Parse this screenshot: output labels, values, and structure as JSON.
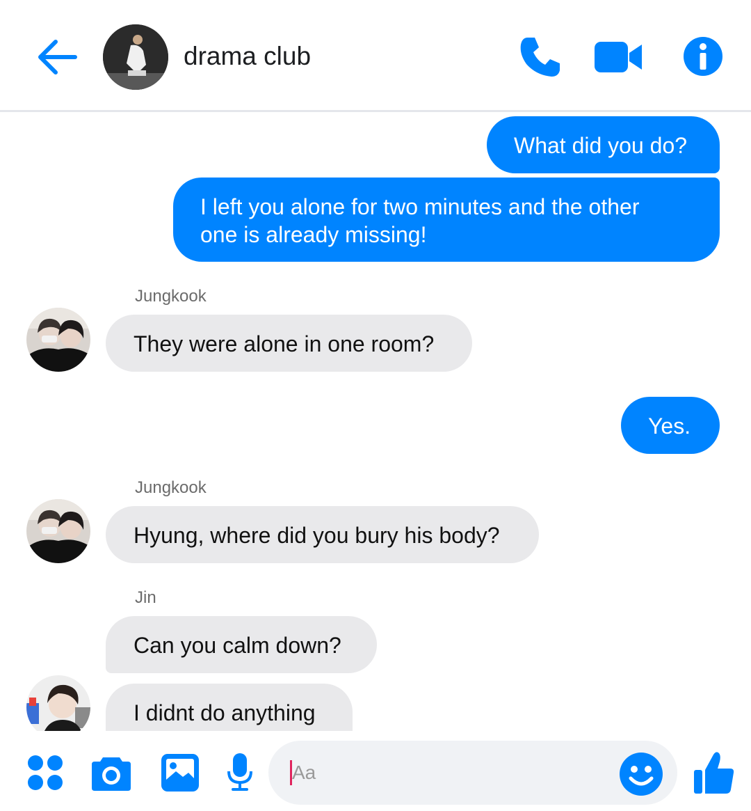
{
  "header": {
    "title": "drama club",
    "back_icon": "arrow-left-icon",
    "call_icon": "phone-icon",
    "video_icon": "video-camera-icon",
    "info_icon": "info-icon"
  },
  "colors": {
    "accent": "#0084ff",
    "incoming_bubble": "#e9e9eb",
    "caret": "#e0245e"
  },
  "messages": [
    {
      "direction": "outgoing",
      "text": "What did you do?"
    },
    {
      "direction": "outgoing",
      "lines": [
        "I left you alone for two minutes and the other",
        "one is already missing!"
      ]
    },
    {
      "direction": "incoming",
      "sender": "Jungkook",
      "text": "They were alone in one room?"
    },
    {
      "direction": "outgoing",
      "text": "Yes."
    },
    {
      "direction": "incoming",
      "sender": "Jungkook",
      "text": "Hyung, where did you bury his body?"
    },
    {
      "direction": "incoming",
      "sender": "Jin",
      "text": "Can you calm down?"
    },
    {
      "direction": "incoming",
      "text": "I didnt do anything"
    }
  ],
  "composer": {
    "placeholder": "Aa",
    "icons": [
      "apps-grid-icon",
      "camera-icon",
      "image-icon",
      "microphone-icon",
      "emoji-icon",
      "thumbs-up-icon"
    ]
  }
}
